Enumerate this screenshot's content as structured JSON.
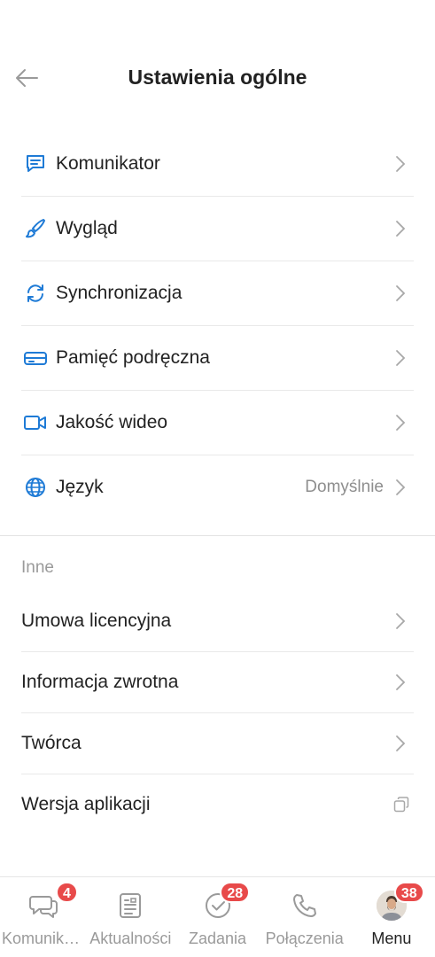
{
  "header": {
    "title": "Ustawienia ogólne"
  },
  "settings": [
    {
      "label": "Komunikator",
      "icon": "chat-icon"
    },
    {
      "label": "Wygląd",
      "icon": "brush-icon"
    },
    {
      "label": "Synchronizacja",
      "icon": "sync-icon"
    },
    {
      "label": "Pamięć podręczna",
      "icon": "cache-icon"
    },
    {
      "label": "Jakość wideo",
      "icon": "video-icon"
    },
    {
      "label": "Język",
      "icon": "globe-icon",
      "value": "Domyślnie"
    }
  ],
  "other": {
    "title": "Inne",
    "items": [
      {
        "label": "Umowa licencyjna"
      },
      {
        "label": "Informacja zwrotna"
      },
      {
        "label": "Twórca"
      },
      {
        "label": "Wersja aplikacji"
      }
    ]
  },
  "tabbar": {
    "tabs": [
      {
        "label": "Komunikator",
        "badge": "4"
      },
      {
        "label": "Aktualności"
      },
      {
        "label": "Zadania",
        "badge": "28"
      },
      {
        "label": "Połączenia"
      },
      {
        "label": "Menu",
        "badge": "38",
        "active": true
      }
    ]
  },
  "colors": {
    "accent": "#1f7bd6",
    "badge": "#e84a4a",
    "muted": "#9a9a9a"
  }
}
